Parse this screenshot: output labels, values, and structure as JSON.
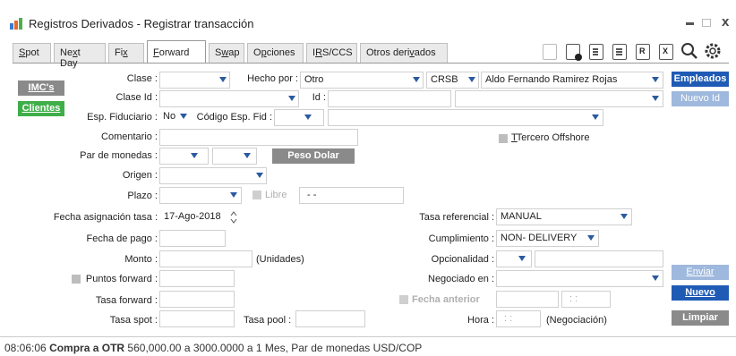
{
  "window": {
    "title": "Registros Derivados - Registrar transacción"
  },
  "tabs": [
    "Spot",
    "Next Day",
    "Fix",
    "Forward",
    "Swap",
    "Opciones",
    "IRS/CCS",
    "Otros derivados"
  ],
  "active_tab": "Forward",
  "side_buttons": {
    "imcs": "IMC's",
    "clientes": "Clientes"
  },
  "right_buttons": {
    "empleados": "Empleados",
    "nuevo_id": "Nuevo Id",
    "enviar": "Enviar",
    "nuevo": "Nuevo",
    "limpiar": "Limpiar"
  },
  "form": {
    "clase": {
      "label": "Clase :",
      "value": ""
    },
    "hecho_por": {
      "label": "Hecho por :",
      "value": "Otro",
      "code": "CRSB",
      "name": "Aldo Fernando Ramirez Rojas"
    },
    "clase_id": {
      "label": "Clase Id :",
      "value": ""
    },
    "id": {
      "label": "Id :",
      "value": ""
    },
    "esp_fiduciario": {
      "label": "Esp. Fiduciario :",
      "value": "No"
    },
    "codigo_esp_fid": {
      "label": "Código Esp. Fid :",
      "value": ""
    },
    "comentario": {
      "label": "Comentario :",
      "value": ""
    },
    "tercero_offshore": {
      "label": "Tercero Offshore"
    },
    "par_monedas": {
      "label": "Par de monedas :"
    },
    "peso_dolar": "Peso Dolar",
    "origen": {
      "label": "Origen :"
    },
    "plazo": {
      "label": "Plazo :",
      "libre": "Libre",
      "date": "-  -"
    },
    "fecha_asignacion": {
      "label": "Fecha asignación tasa :",
      "value": "17-Ago-2018"
    },
    "tasa_referencial": {
      "label": "Tasa referencial :",
      "value": "MANUAL"
    },
    "fecha_pago": {
      "label": "Fecha de pago :"
    },
    "cumplimiento": {
      "label": "Cumplimiento :",
      "value": "NON- DELIVERY"
    },
    "monto": {
      "label": "Monto :",
      "unit": "(Unidades)"
    },
    "opcionalidad": {
      "label": "Opcionalidad :"
    },
    "puntos_forward": {
      "label": "Puntos forward :"
    },
    "negociado_en": {
      "label": "Negociado en :"
    },
    "tasa_forward": {
      "label": "Tasa forward :"
    },
    "fecha_anterior": {
      "label": "Fecha anterior",
      "time": ": :"
    },
    "tasa_spot": {
      "label": "Tasa spot :"
    },
    "tasa_pool": {
      "label": "Tasa pool :"
    },
    "hora": {
      "label": "Hora :",
      "value": ": :",
      "note": "(Negociación)"
    }
  },
  "status": {
    "time": "08:06:06",
    "bold": "Compra a OTR",
    "rest": "560,000.00 a 3000.0000 a 1 Mes, Par de monedas USD/COP"
  },
  "colors": {
    "blue": "#1f5bb5",
    "green": "#3fae49",
    "gray": "#8a8a8a",
    "disabled_blue": "#9fb8dd"
  }
}
